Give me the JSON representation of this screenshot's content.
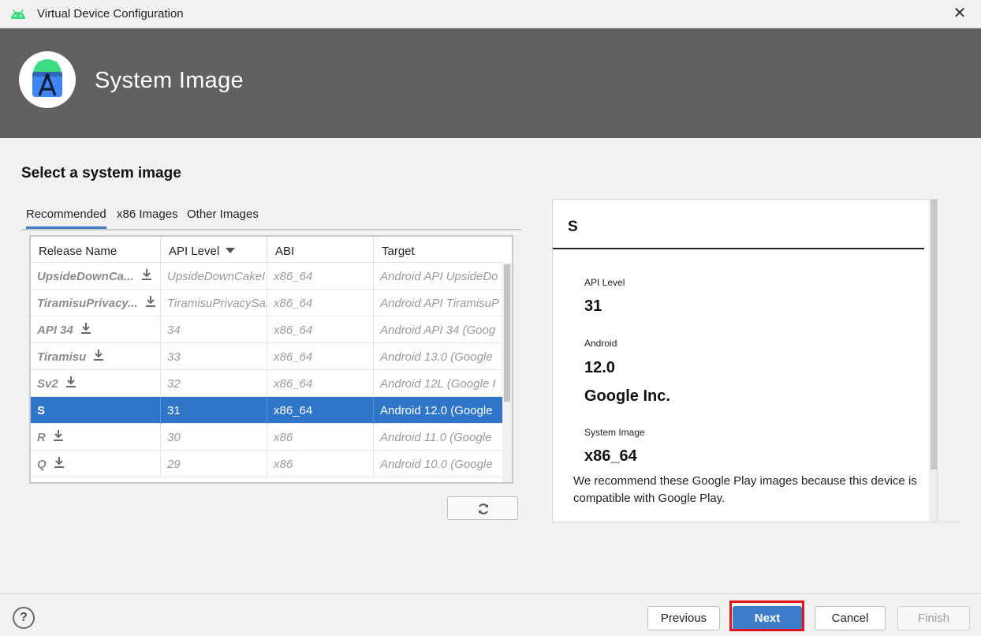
{
  "window": {
    "title": "Virtual Device Configuration",
    "close_glyph": "✕"
  },
  "banner": {
    "heading": "System Image"
  },
  "section_title": "Select a system image",
  "tabs": [
    {
      "label": "Recommended",
      "active": true
    },
    {
      "label": "x86 Images",
      "active": false
    },
    {
      "label": "Other Images",
      "active": false
    }
  ],
  "table": {
    "columns": [
      "Release Name",
      "API Level",
      "ABI",
      "Target"
    ],
    "sorted_column": "API Level",
    "rows": [
      {
        "name": "UpsideDownCa...",
        "api": "UpsideDownCakeI",
        "abi": "x86_64",
        "target": "Android API UpsideDo",
        "download": true
      },
      {
        "name": "TiramisuPrivacy...",
        "api": "TiramisuPrivacySar",
        "abi": "x86_64",
        "target": "Android API TiramisuP",
        "download": true
      },
      {
        "name": "API 34",
        "api": "34",
        "abi": "x86_64",
        "target": "Android API 34 (Goog",
        "download": true
      },
      {
        "name": "Tiramisu",
        "api": "33",
        "abi": "x86_64",
        "target": "Android 13.0 (Google",
        "download": true
      },
      {
        "name": "Sv2",
        "api": "32",
        "abi": "x86_64",
        "target": "Android 12L (Google I",
        "download": true
      },
      {
        "name": "S",
        "api": "31",
        "abi": "x86_64",
        "target": "Android 12.0 (Google",
        "download": false,
        "selected": true
      },
      {
        "name": "R",
        "api": "30",
        "abi": "x86",
        "target": "Android 11.0 (Google",
        "download": true
      },
      {
        "name": "Q",
        "api": "29",
        "abi": "x86",
        "target": "Android 10.0 (Google",
        "download": true
      }
    ]
  },
  "details": {
    "title": "S",
    "api_level_label": "API Level",
    "api_level_value": "31",
    "android_label": "Android",
    "android_version": "12.0",
    "vendor": "Google Inc.",
    "system_image_label": "System Image",
    "system_image_value": "x86_64",
    "recommendation": "We recommend these Google Play images because this device is compatible with Google Play."
  },
  "footer": {
    "help_label": "?",
    "previous_label": "Previous",
    "next_label": "Next",
    "cancel_label": "Cancel",
    "finish_label": "Finish"
  },
  "colors": {
    "accent": "#3d7cc9",
    "selection": "#2f75c8",
    "banner": "#616161",
    "highlight_outline": "#e0141e",
    "android_green": "#3ddc84"
  },
  "icons": {
    "app": "android-icon",
    "logo": "android-studio-logo",
    "download": "download-icon",
    "refresh": "refresh-icon",
    "sort": "sort-descending-icon"
  }
}
